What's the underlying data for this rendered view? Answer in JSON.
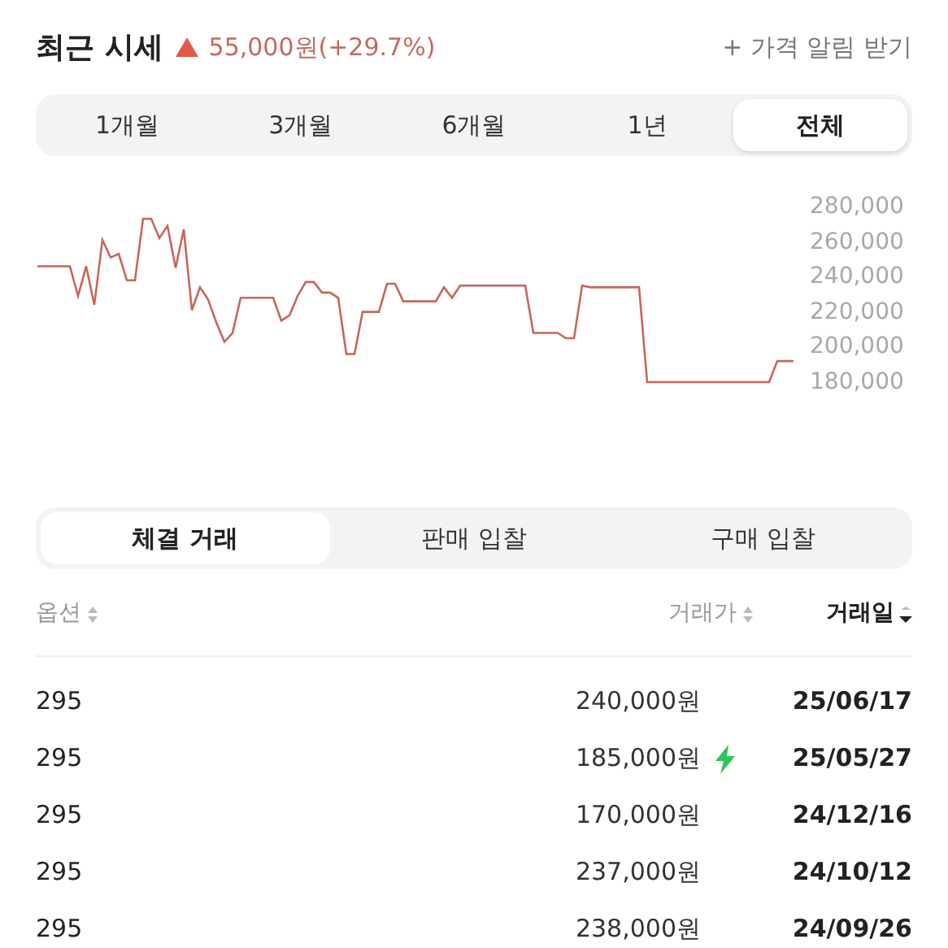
{
  "header": {
    "title": "최근 시세",
    "change": "55,000원(+29.7%)",
    "alert_link": "+ 가격 알림 받기"
  },
  "period_tabs": [
    {
      "label": "1개월",
      "selected": false
    },
    {
      "label": "3개월",
      "selected": false
    },
    {
      "label": "6개월",
      "selected": false
    },
    {
      "label": "1년",
      "selected": false
    },
    {
      "label": "전체",
      "selected": true
    }
  ],
  "chart_data": {
    "type": "line",
    "ylim": [
      180000,
      280000
    ],
    "yticks": [
      {
        "value": 280000,
        "label": "280,000"
      },
      {
        "value": 260000,
        "label": "260,000"
      },
      {
        "value": 240000,
        "label": "240,000"
      },
      {
        "value": 220000,
        "label": "220,000"
      },
      {
        "value": 200000,
        "label": "200,000"
      },
      {
        "value": 180000,
        "label": "180,000"
      }
    ],
    "series": [
      {
        "color": "#c8665a",
        "values": [
          246000,
          246000,
          246000,
          246000,
          246000,
          229000,
          246000,
          224000,
          261000,
          251000,
          253000,
          238000,
          238000,
          273000,
          273000,
          262000,
          269000,
          245000,
          267000,
          221000,
          234000,
          227000,
          214000,
          203000,
          208000,
          228000,
          228000,
          228000,
          228000,
          228000,
          215000,
          218000,
          229000,
          237000,
          237000,
          231000,
          231000,
          228000,
          196000,
          196000,
          220000,
          220000,
          220000,
          236000,
          236000,
          226000,
          226000,
          226000,
          226000,
          226000,
          234000,
          228000,
          235000,
          235000,
          235000,
          235000,
          235000,
          235000,
          235000,
          235000,
          235000,
          208000,
          208000,
          208000,
          208000,
          205000,
          205000,
          235000,
          234000,
          234000,
          234000,
          234000,
          234000,
          234000,
          234000,
          180000,
          180000,
          180000,
          180000,
          180000,
          180000,
          180000,
          180000,
          180000,
          180000,
          180000,
          180000,
          180000,
          180000,
          180000,
          180000,
          192000,
          192000,
          192000
        ]
      }
    ]
  },
  "trade_tabs": [
    {
      "label": "체결 거래",
      "selected": true
    },
    {
      "label": "판매 입찰",
      "selected": false
    },
    {
      "label": "구매 입찰",
      "selected": false
    }
  ],
  "table": {
    "columns": [
      {
        "label": "옵션",
        "selected": false
      },
      {
        "label": "거래가",
        "selected": false
      },
      {
        "label": "거래일",
        "selected": true
      }
    ],
    "rows": [
      {
        "option": "295",
        "price": "240,000원",
        "quick": false,
        "date": "25/06/17"
      },
      {
        "option": "295",
        "price": "185,000원",
        "quick": true,
        "date": "25/05/27"
      },
      {
        "option": "295",
        "price": "170,000원",
        "quick": false,
        "date": "24/12/16"
      },
      {
        "option": "295",
        "price": "237,000원",
        "quick": false,
        "date": "24/10/12"
      },
      {
        "option": "295",
        "price": "238,000원",
        "quick": false,
        "date": "24/09/26"
      }
    ]
  }
}
